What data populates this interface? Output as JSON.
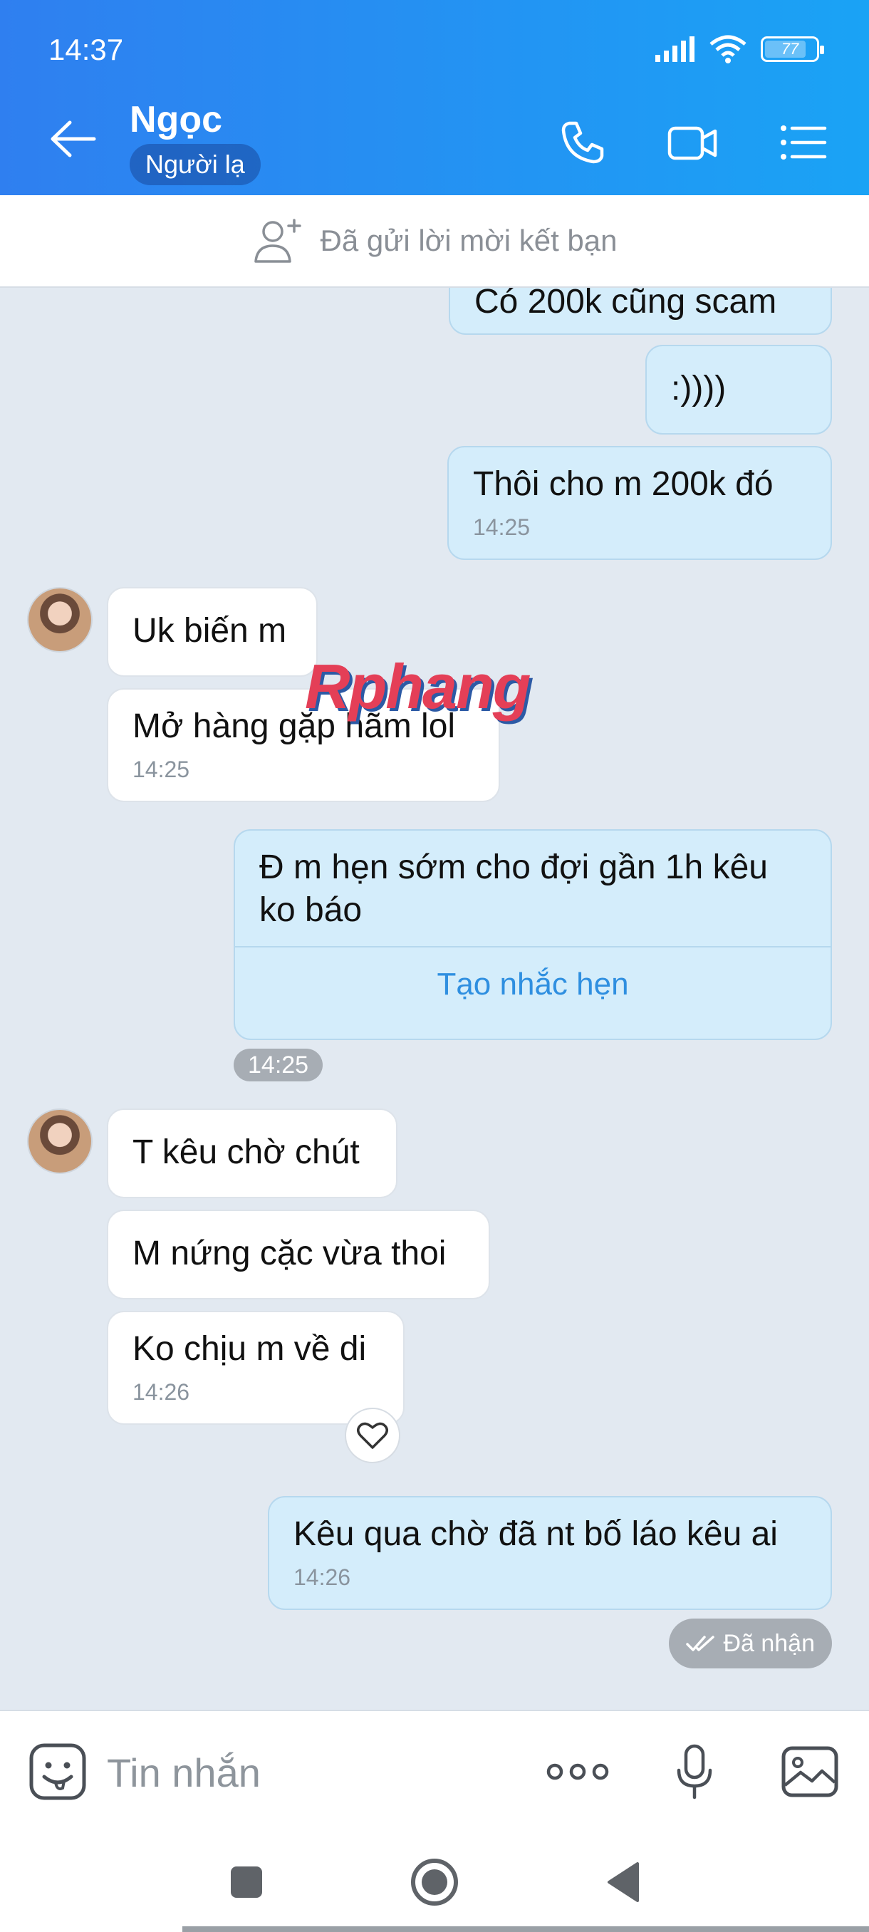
{
  "status_bar": {
    "time": "14:37",
    "battery_level": "77"
  },
  "header": {
    "contact_name": "Ngọc",
    "badge": "Người lạ"
  },
  "friend_bar": {
    "text": "Đã gửi lời mời kết bạn"
  },
  "messages": [
    {
      "sender": "me",
      "text": "Có 200k cũng scam"
    },
    {
      "sender": "me",
      "text": ":))))"
    },
    {
      "sender": "me",
      "text": "Thôi cho m 200k đó",
      "time": "14:25"
    },
    {
      "sender": "them",
      "text": "Uk biến m"
    },
    {
      "sender": "them",
      "text": "Mở hàng gặp hãm lol",
      "time": "14:25"
    },
    {
      "sender": "me",
      "text": "Đ m hẹn sớm cho đợi gần 1h kêu ko báo",
      "action": "Tạo nhắc hẹn",
      "time": "14:25"
    },
    {
      "sender": "them",
      "text": "T kêu chờ chút"
    },
    {
      "sender": "them",
      "text": "M nứng cặc vừa thoi"
    },
    {
      "sender": "them",
      "text": "Ko chịu m về di",
      "time": "14:26"
    },
    {
      "sender": "me",
      "text": "Kêu qua chờ đã nt bố láo kêu ai",
      "time": "14:26"
    }
  ],
  "watermark": "Rphang",
  "delivery_status": "Đã nhận",
  "input": {
    "placeholder": "Tin nhắn"
  },
  "colors": {
    "header_start": "#2f7ff0",
    "header_end": "#1aa3f5",
    "my_bubble": "#d4edfb",
    "link": "#2f8fe0"
  }
}
